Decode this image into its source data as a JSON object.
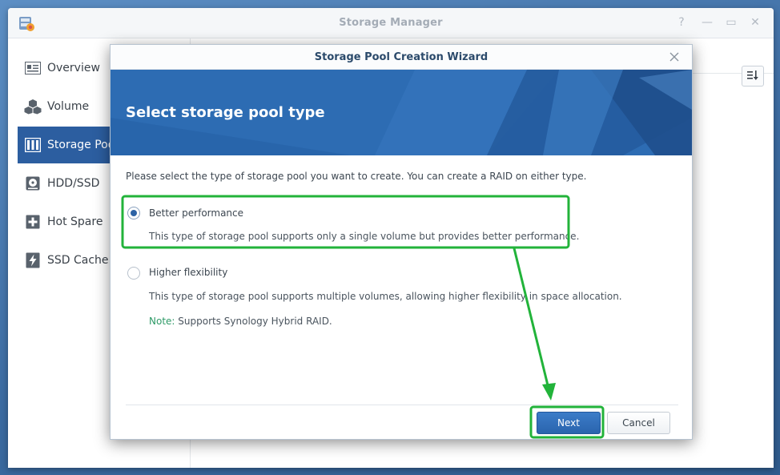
{
  "window": {
    "title": "Storage Manager",
    "controls": {
      "help": "?",
      "minimize": "—",
      "maximize": "▭",
      "close": "✕"
    }
  },
  "sidebar": {
    "items": [
      {
        "label": "Overview",
        "icon": "overview-icon"
      },
      {
        "label": "Volume",
        "icon": "cubes-icon"
      },
      {
        "label": "Storage Pool",
        "icon": "storage-pool-icon",
        "active": true
      },
      {
        "label": "HDD/SSD",
        "icon": "hdd-icon"
      },
      {
        "label": "Hot Spare",
        "icon": "plus-box-icon"
      },
      {
        "label": "SSD Cache",
        "icon": "lightning-icon"
      }
    ]
  },
  "dialog": {
    "title": "Storage Pool Creation Wizard",
    "heading": "Select storage pool type",
    "intro": "Please select the type of storage pool you want to create. You can create a RAID on either type.",
    "options": [
      {
        "title": "Better performance",
        "description": "This type of storage pool supports only a single volume but provides better performance.",
        "selected": true
      },
      {
        "title": "Higher flexibility",
        "description": "This type of storage pool supports multiple volumes, allowing higher flexibility in space allocation.",
        "selected": false
      }
    ],
    "note_label": "Note:",
    "note_text": " Supports Synology Hybrid RAID.",
    "next_label": "Next",
    "cancel_label": "Cancel"
  },
  "colors": {
    "accent": "#2c5ea0",
    "annotation": "#22b33a",
    "note": "#2e9a67"
  }
}
